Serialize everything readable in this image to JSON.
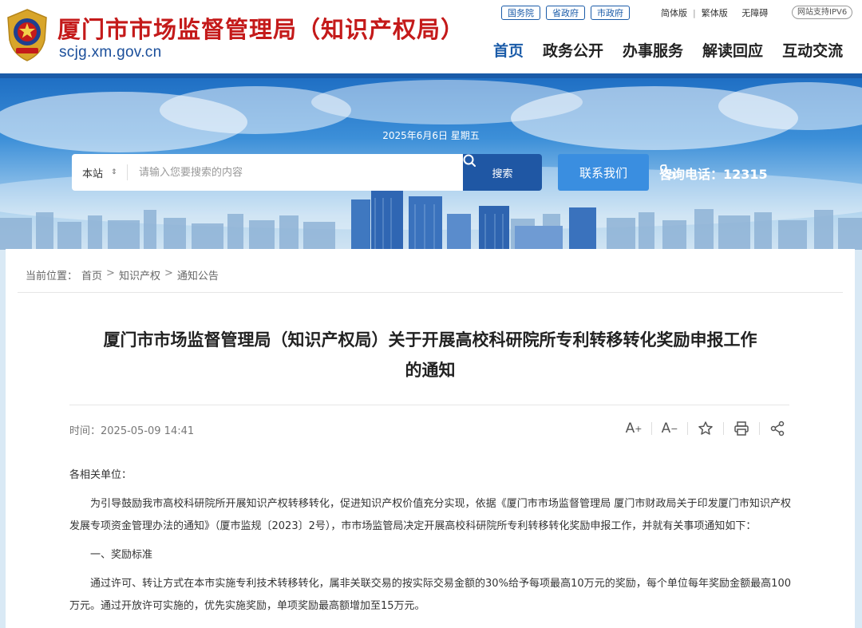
{
  "header": {
    "site_title": "厦门市市场监督管理局（知识产权局）",
    "site_domain": "scjg.xm.gov.cn",
    "top_links": [
      "国务院",
      "省政府",
      "市政府"
    ],
    "lang_links": [
      "简体版",
      "繁体版",
      "无障碍"
    ],
    "ipv6_badge": "网站支持IPV6",
    "nav": [
      "首页",
      "政务公开",
      "办事服务",
      "解读回应",
      "互动交流"
    ]
  },
  "banner": {
    "date": "2025年6月6日 星期五",
    "search_scope": "本站",
    "search_placeholder": "请输入您要搜索的内容",
    "search_button": "搜索",
    "contact_button": "联系我们",
    "hotline": "咨询电话：12315"
  },
  "breadcrumb": {
    "label": "当前位置：",
    "items": [
      "首页",
      "知识产权",
      "通知公告"
    ]
  },
  "article": {
    "title_line1": "厦门市市场监督管理局（知识产权局）关于开展高校科研院所专利转移转化奖励申报工作",
    "title_line2": "的通知",
    "time": "时间：2025-05-09 14:41",
    "paragraphs": [
      "各相关单位：",
      "为引导鼓励我市高校科研院所开展知识产权转移转化，促进知识产权价值充分实现，依据《厦门市市场监督管理局 厦门市财政局关于印发厦门市知识产权发展专项资金管理办法的通知》（厦市监规〔2023〕2号），市市场监管局决定开展高校科研院所专利转移转化奖励申报工作，并就有关事项通知如下：",
      "一、奖励标准",
      "通过许可、转让方式在本市实施专利技术转移转化，属非关联交易的按实际交易金额的30%给予每项最高10万元的奖励，每个单位每年奖励金额最高100万元。通过开放许可实施的，优先实施奖励，单项奖励最高额增加至15万元。"
    ]
  },
  "tools": [
    "font-increase-icon",
    "font-decrease-icon",
    "star-icon",
    "print-icon",
    "share-icon"
  ],
  "colors": {
    "brand_blue": "#1a5ba8",
    "title_red": "#c41a1a",
    "search_button": "#1f57a4",
    "contact_button": "#3a8ee0"
  }
}
